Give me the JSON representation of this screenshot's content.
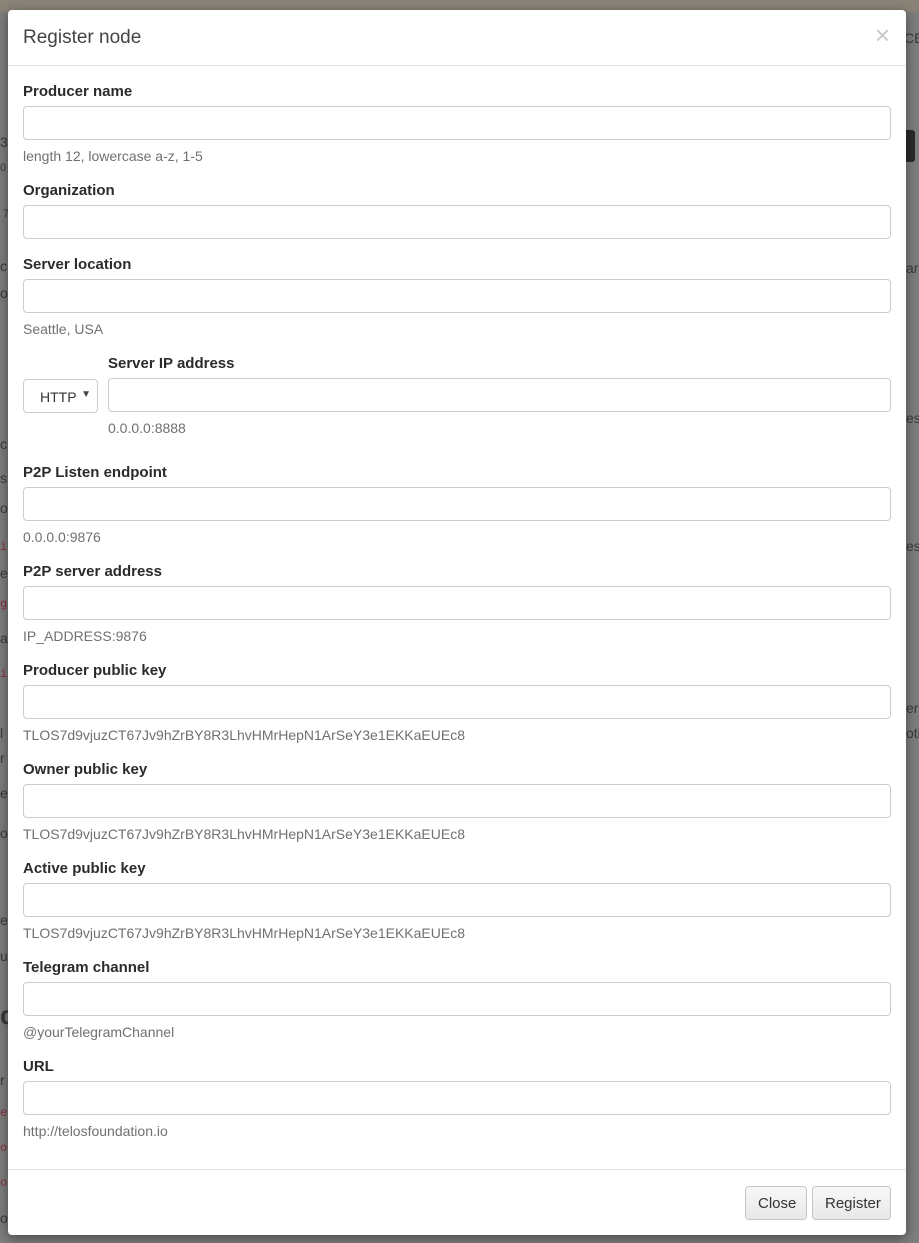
{
  "background": {
    "fragments": [
      "CE",
      "39",
      "0",
      "7",
      "ar",
      "c",
      "o",
      "es i",
      "c",
      "s",
      "o",
      "i",
      "es",
      "es",
      "g",
      "a",
      "i",
      "er",
      "l",
      "oti",
      "r",
      "e",
      "o",
      "e",
      "u",
      "d",
      "r",
      "e",
      "o",
      "o",
      "o"
    ]
  },
  "modal": {
    "title": "Register node",
    "close_icon": "×",
    "fields": {
      "producer_name": {
        "label": "Producer name",
        "value": "",
        "help": "length 12, lowercase a-z, 1-5"
      },
      "organization": {
        "label": "Organization",
        "value": ""
      },
      "server_location": {
        "label": "Server location",
        "value": "",
        "help": "Seattle, USA"
      },
      "protocol": {
        "selected": "HTTP"
      },
      "server_ip": {
        "label": "Server IP address",
        "value": "",
        "help": "0.0.0.0:8888"
      },
      "p2p_listen": {
        "label": "P2P Listen endpoint",
        "value": "",
        "help": "0.0.0.0:9876"
      },
      "p2p_server": {
        "label": "P2P server address",
        "value": "",
        "help": "IP_ADDRESS:9876"
      },
      "producer_key": {
        "label": "Producer public key",
        "value": "",
        "help": "TLOS7d9vjuzCT67Jv9hZrBY8R3LhvHMrHepN1ArSeY3e1EKKaEUEc8"
      },
      "owner_key": {
        "label": "Owner public key",
        "value": "",
        "help": "TLOS7d9vjuzCT67Jv9hZrBY8R3LhvHMrHepN1ArSeY3e1EKKaEUEc8"
      },
      "active_key": {
        "label": "Active public key",
        "value": "",
        "help": "TLOS7d9vjuzCT67Jv9hZrBY8R3LhvHMrHepN1ArSeY3e1EKKaEUEc8"
      },
      "telegram": {
        "label": "Telegram channel",
        "value": "",
        "help": "@yourTelegramChannel"
      },
      "url": {
        "label": "URL",
        "value": "",
        "help": "http://telosfoundation.io"
      }
    },
    "footer": {
      "close_label": "Close",
      "register_label": "Register"
    }
  }
}
